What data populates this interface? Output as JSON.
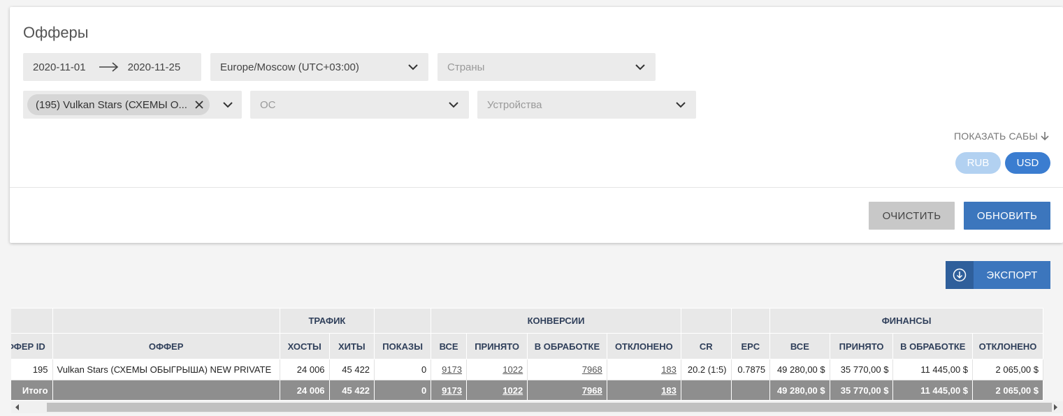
{
  "page": {
    "title": "Офферы"
  },
  "filters": {
    "date_from": "2020-11-01",
    "date_to": "2020-11-25",
    "timezone": "Europe/Moscow (UTC+03:00)",
    "countries_placeholder": "Страны",
    "offer_chip": "(195) Vulkan Stars (СХЕМЫ О...",
    "os_placeholder": "ОС",
    "devices_placeholder": "Устройства",
    "show_subs": "ПОКАЗАТЬ САБЫ",
    "currency_rub": "RUB",
    "currency_usd": "USD",
    "clear_label": "ОЧИСТИТЬ",
    "refresh_label": "ОБНОВИТЬ"
  },
  "export_label": "ЭКСПОРТ",
  "table": {
    "groups": {
      "traffic": "ТРАФИК",
      "conversions": "КОНВЕРСИИ",
      "finance": "ФИНАНСЫ"
    },
    "columns": {
      "offer_id": "ОФФЕР ID",
      "offer": "ОФФЕР",
      "hosts": "ХОСТЫ",
      "hits": "ХИТЫ",
      "shows": "ПОКАЗЫ",
      "conv_all": "ВСЕ",
      "conv_accepted": "ПРИНЯТО",
      "conv_processing": "В ОБРАБОТКЕ",
      "conv_rejected": "ОТКЛОНЕНО",
      "cr": "CR",
      "epc": "EPC",
      "fin_all": "ВСЕ",
      "fin_accepted": "ПРИНЯТО",
      "fin_processing": "В ОБРАБОТКЕ",
      "fin_rejected": "ОТКЛОНЕНО"
    },
    "rows": [
      {
        "offer_id": "195",
        "offer": "Vulkan Stars (СХЕМЫ ОБЫГРЫША) NEW PRIVATE",
        "hosts": "24 006",
        "hits": "45 422",
        "shows": "0",
        "conv_all": "9173",
        "conv_accepted": "1022",
        "conv_processing": "7968",
        "conv_rejected": "183",
        "cr": "20.2 (1:5)",
        "epc": "0.7875",
        "fin_all": "49 280,00 $",
        "fin_accepted": "35 770,00 $",
        "fin_processing": "11 445,00 $",
        "fin_rejected": "2 065,00 $"
      }
    ],
    "total": {
      "label": "Итого",
      "hosts": "24 006",
      "hits": "45 422",
      "shows": "0",
      "conv_all": "9173",
      "conv_accepted": "1022",
      "conv_processing": "7968",
      "conv_rejected": "183",
      "fin_all": "49 280,00 $",
      "fin_accepted": "35 770,00 $",
      "fin_processing": "11 445,00 $",
      "fin_rejected": "2 065,00 $"
    }
  },
  "colors": {
    "primary": "#3c76bd",
    "usd_active": "#3b7dd0",
    "rub_inactive": "#b2d1f1",
    "total_row": "#8e8e8e"
  }
}
